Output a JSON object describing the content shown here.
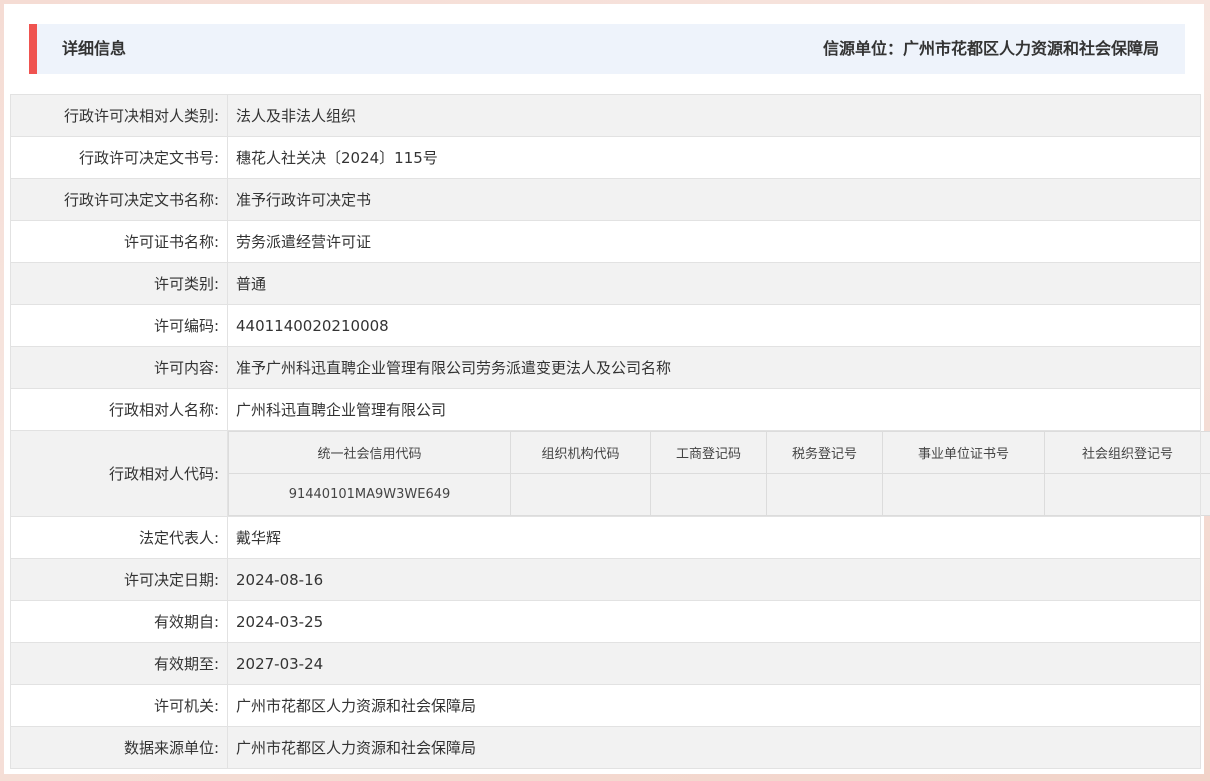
{
  "header": {
    "title": "详细信息",
    "source": "信源单位：广州市花都区人力资源和社会保障局"
  },
  "rows_top": [
    {
      "label": "行政许可决相对人类别:",
      "value": "法人及非法人组织"
    },
    {
      "label": "行政许可决定文书号:",
      "value": "穗花人社关决〔2024〕115号"
    },
    {
      "label": "行政许可决定文书名称:",
      "value": "准予行政许可决定书"
    },
    {
      "label": "许可证书名称:",
      "value": "劳务派遣经营许可证"
    },
    {
      "label": "许可类别:",
      "value": "普通"
    },
    {
      "label": "许可编码:",
      "value": "4401140020210008"
    },
    {
      "label": "许可内容:",
      "value": "准予广州科迅直聘企业管理有限公司劳务派遣变更法人及公司名称"
    },
    {
      "label": "行政相对人名称:",
      "value": "广州科迅直聘企业管理有限公司"
    }
  ],
  "code_row": {
    "label": "行政相对人代码:",
    "columns": [
      "统一社会信用代码",
      "组织机构代码",
      "工商登记码",
      "税务登记号",
      "事业单位证书号",
      "社会组织登记号"
    ],
    "values": [
      "91440101MA9W3WE649",
      "",
      "",
      "",
      "",
      ""
    ]
  },
  "rows_bottom": [
    {
      "label": "法定代表人:",
      "value": "戴华辉"
    },
    {
      "label": "许可决定日期:",
      "value": "2024-08-16"
    },
    {
      "label": "有效期自:",
      "value": "2024-03-25"
    },
    {
      "label": "有效期至:",
      "value": "2027-03-24"
    },
    {
      "label": "许可机关:",
      "value": "广州市花都区人力资源和社会保障局"
    },
    {
      "label": "数据来源单位:",
      "value": "广州市花都区人力资源和社会保障局"
    }
  ]
}
